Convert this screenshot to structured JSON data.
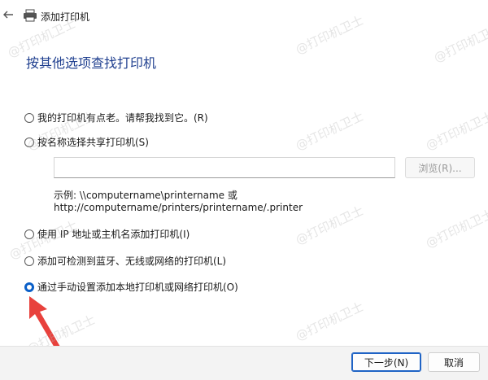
{
  "window": {
    "title": "添加打印机"
  },
  "heading": "按其他选项查找打印机",
  "options": [
    {
      "label": "我的打印机有点老。请帮我找到它。(R)",
      "selected": false
    },
    {
      "label": "按名称选择共享打印机(S)",
      "selected": false
    },
    {
      "label": "使用 IP 地址或主机名添加打印机(I)",
      "selected": false
    },
    {
      "label": "添加可检测到蓝牙、无线或网络的打印机(L)",
      "selected": false
    },
    {
      "label": "通过手动设置添加本地打印机或网络打印机(O)",
      "selected": true
    }
  ],
  "shared_printer": {
    "value": "",
    "browse_label": "浏览(R)...",
    "example_line1": "示例: \\\\computername\\printername 或",
    "example_line2": "http://computername/printers/printername/.printer"
  },
  "buttons": {
    "next": "下一步(N)",
    "cancel": "取消"
  },
  "watermark": "@打印机卫士",
  "colors": {
    "accent": "#0a5fc8",
    "heading": "#1f3f8f",
    "annotation_arrow": "#e8413c"
  }
}
